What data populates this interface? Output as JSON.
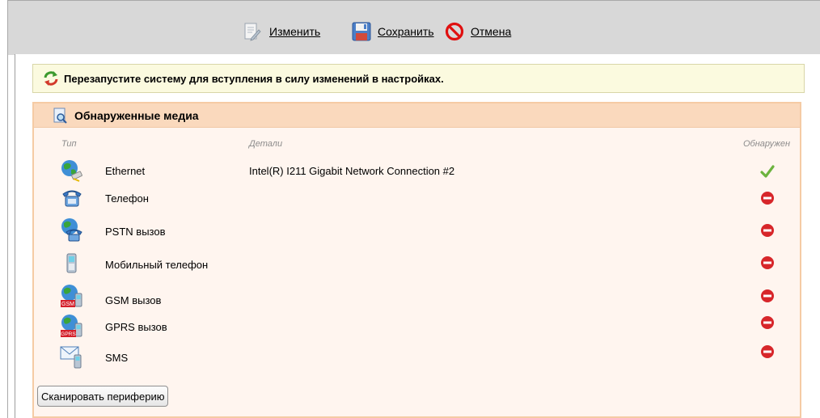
{
  "toolbar": {
    "edit_label": "Изменить",
    "save_label": "Сохранить",
    "cancel_label": "Отмена"
  },
  "notice": {
    "text": "Перезапустите систему для вступления в силу изменений в настройках."
  },
  "panel": {
    "title": "Обнаруженные медиа",
    "columns": {
      "type": "Тип",
      "details": "Детали",
      "detected": "Обнаружен"
    },
    "rows": [
      {
        "icon": "ethernet-icon",
        "name": "Ethernet",
        "details": "Intel(R) I211 Gigabit Network Connection #2",
        "status": "detected"
      },
      {
        "icon": "telephone-icon",
        "name": "Телефон",
        "details": "",
        "status": "not-detected"
      },
      {
        "icon": "pstn-icon",
        "name": "PSTN вызов",
        "details": "",
        "status": "not-detected"
      },
      {
        "icon": "mobile-phone-icon",
        "name": "Мобильный телефон",
        "details": "",
        "status": "not-detected"
      },
      {
        "icon": "gsm-icon",
        "name": "GSM вызов",
        "details": "",
        "status": "not-detected",
        "badge": "GSM"
      },
      {
        "icon": "gprs-icon",
        "name": "GPRS вызов",
        "details": "",
        "status": "not-detected",
        "badge": "GPRS"
      },
      {
        "icon": "sms-icon",
        "name": "SMS",
        "details": "",
        "status": "not-detected"
      }
    ],
    "scan_button": "Сканировать периферию"
  },
  "colors": {
    "toolbar_bg": "#d8d8d8",
    "notice_bg": "#fbfadf",
    "panel_header_bg": "#fad9bd",
    "panel_bg": "#fff5ef",
    "panel_border": "#f5cba4",
    "ok_green": "#6cb33e",
    "stop_red": "#d7262a"
  }
}
